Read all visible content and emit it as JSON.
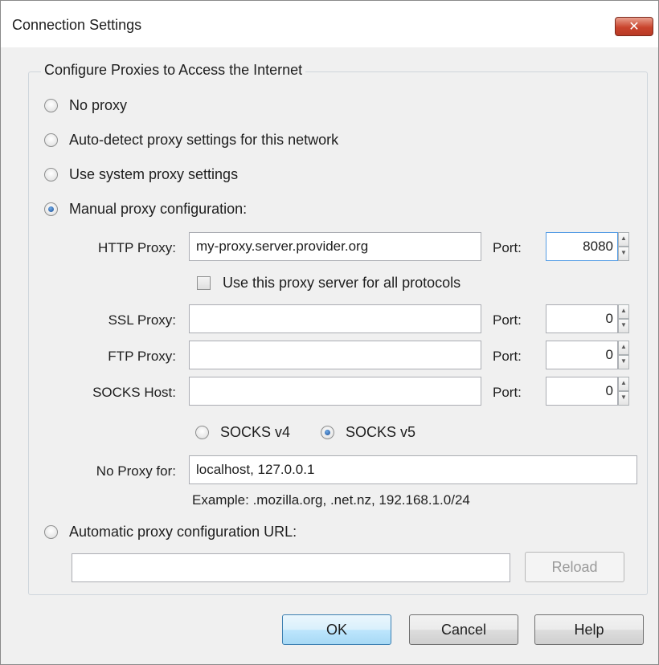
{
  "window": {
    "title": "Connection Settings",
    "close_label": "✕"
  },
  "group": {
    "legend": "Configure Proxies to Access the Internet"
  },
  "options": {
    "no_proxy": "No proxy",
    "auto_detect": "Auto-detect proxy settings for this network",
    "system": "Use system proxy settings",
    "manual": "Manual proxy configuration:",
    "auto_url": "Automatic proxy configuration URL:",
    "selected": "manual"
  },
  "manual": {
    "http_label": "HTTP Proxy:",
    "http_value": "my-proxy.server.provider.org",
    "http_port_label": "Port:",
    "http_port": "8080",
    "share_label": "Use this proxy server for all protocols",
    "share_checked": false,
    "ssl_label": "SSL Proxy:",
    "ssl_value": "",
    "ssl_port_label": "Port:",
    "ssl_port": "0",
    "ftp_label": "FTP Proxy:",
    "ftp_value": "",
    "ftp_port_label": "Port:",
    "ftp_port": "0",
    "socks_label": "SOCKS Host:",
    "socks_value": "",
    "socks_port_label": "Port:",
    "socks_port": "0",
    "socks_v4": "SOCKS v4",
    "socks_v5": "SOCKS v5",
    "socks_version_selected": "v5",
    "no_proxy_label": "No Proxy for:",
    "no_proxy_value": "localhost, 127.0.0.1",
    "example": "Example: .mozilla.org, .net.nz, 192.168.1.0/24"
  },
  "auto_config": {
    "url_value": "",
    "reload_label": "Reload"
  },
  "buttons": {
    "ok": "OK",
    "cancel": "Cancel",
    "help": "Help"
  }
}
